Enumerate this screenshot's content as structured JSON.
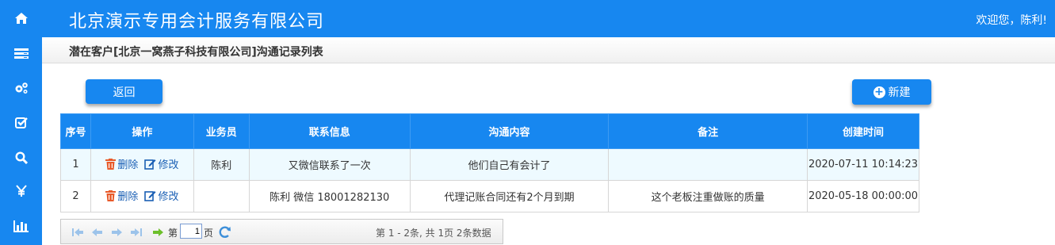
{
  "header": {
    "company": "北京演示专用会计服务有限公司",
    "welcome": "欢迎您，陈利!"
  },
  "sidebar": {
    "items": [
      {
        "icon": "home-icon"
      },
      {
        "icon": "list-icon"
      },
      {
        "icon": "gears-icon"
      },
      {
        "icon": "check-square-icon"
      },
      {
        "icon": "search-icon"
      },
      {
        "icon": "yen-icon"
      },
      {
        "icon": "bar-chart-icon"
      }
    ]
  },
  "page": {
    "title": "潜在客户[北京一窝燕子科技有限公司]沟通记录列表"
  },
  "toolbar": {
    "back_label": "返回",
    "new_label": "新建"
  },
  "table": {
    "headers": [
      "序号",
      "操作",
      "业务员",
      "联系信息",
      "沟通内容",
      "备注",
      "创建时间"
    ],
    "delete_label": "删除",
    "edit_label": "修改",
    "rows": [
      {
        "no": "1",
        "staff": "陈利",
        "contact": "又微信联系了一次",
        "content": "他们自己有会计了",
        "remark": "",
        "created": "2020-07-11 10:14:23"
      },
      {
        "no": "2",
        "staff": "",
        "contact": "陈利 微信 18001282130",
        "content": "代理记账合同还有2个月到期",
        "remark": "这个老板注重做账的质量",
        "created": "2020-05-18 00:00:00"
      }
    ]
  },
  "pager": {
    "page_prefix": "第",
    "page_value": "1",
    "page_suffix": "页",
    "info": "第 1 - 2条, 共 1页 2条数据"
  },
  "colors": {
    "accent": "#1787f0",
    "link": "#1a5fb4",
    "delete_icon": "#e85a2a"
  }
}
